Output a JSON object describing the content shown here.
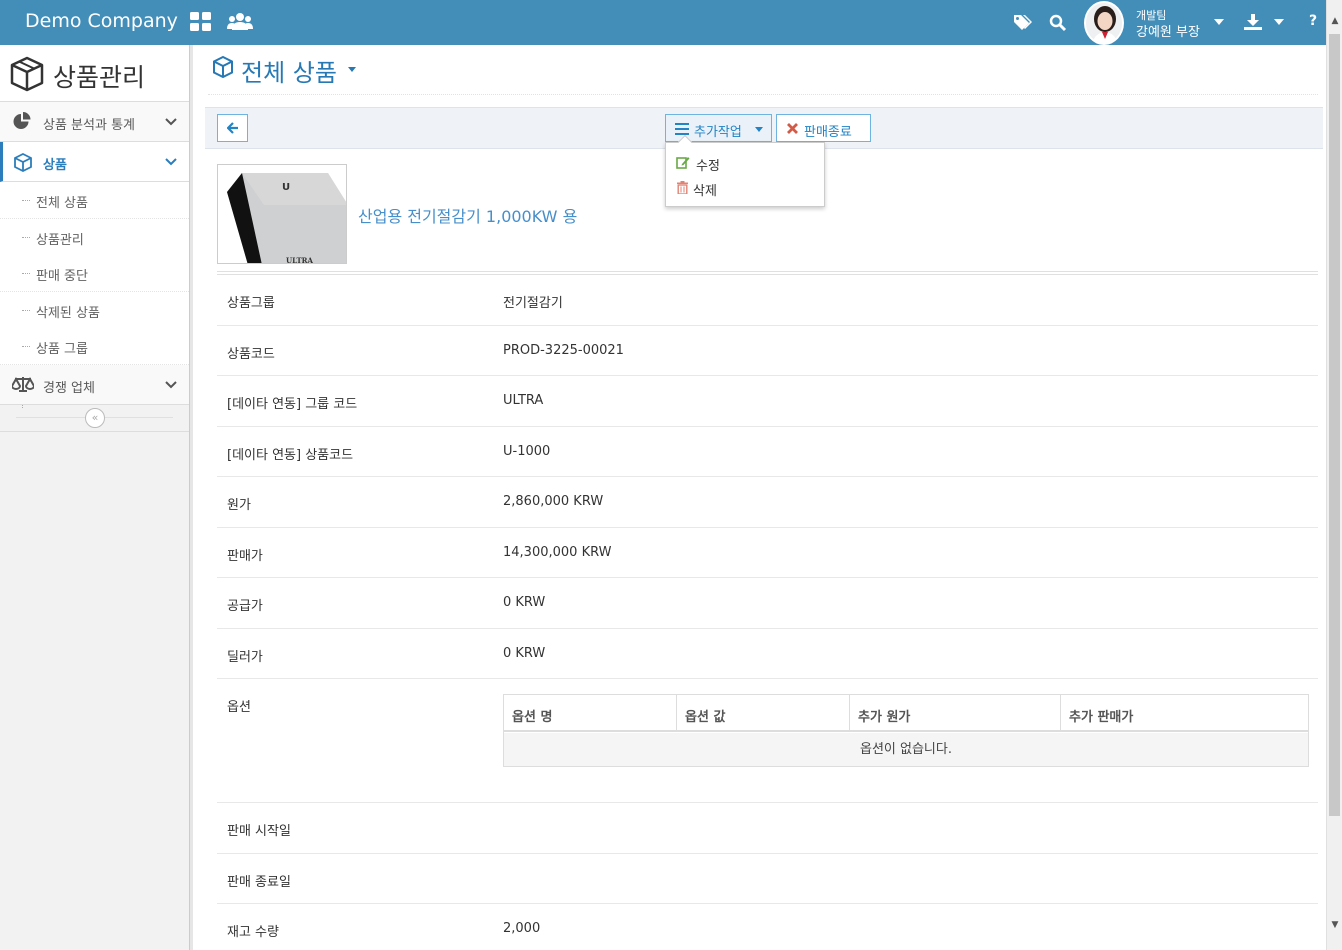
{
  "app": {
    "company": "Demo Company",
    "user_team": "개발팀",
    "user_name": "강예원 부장"
  },
  "sidebar": {
    "title": "상품관리",
    "items": [
      {
        "label": "상품 분석과 통계"
      },
      {
        "label": "상품"
      },
      {
        "label": "경쟁 업체"
      }
    ],
    "sub_items": [
      {
        "label": "전체 상품"
      },
      {
        "label": "상품관리"
      },
      {
        "label": "판매 중단"
      },
      {
        "label": "삭제된 상품"
      },
      {
        "label": "상품 그룹"
      }
    ]
  },
  "page": {
    "title": "전체 상품"
  },
  "toolbar": {
    "more_label": "추가작업",
    "end_sale_label": "판매종료"
  },
  "dropdown": {
    "items": [
      {
        "label": "수정",
        "icon": "edit-icon"
      },
      {
        "label": "삭제",
        "icon": "trash-icon"
      }
    ]
  },
  "product": {
    "name": "산업용 전기절감기 1,000KW 용",
    "thumb_text": "ULTRA",
    "thumb_logo": "U"
  },
  "details": [
    {
      "label": "상품그룹",
      "value": "전기절감기"
    },
    {
      "label": "상품코드",
      "value": "PROD-3225-00021"
    },
    {
      "label": "[데이타 연동] 그룹 코드",
      "value": "ULTRA"
    },
    {
      "label": "[데이타 연동] 상품코드",
      "value": "U-1000"
    },
    {
      "label": "원가",
      "value": "2,860,000 KRW"
    },
    {
      "label": "판매가",
      "value": "14,300,000 KRW"
    },
    {
      "label": "공급가",
      "value": "0 KRW"
    },
    {
      "label": "딜러가",
      "value": "0 KRW"
    },
    {
      "label": "옵션",
      "value": ""
    },
    {
      "label": "판매 시작일",
      "value": ""
    },
    {
      "label": "판매 종료일",
      "value": ""
    },
    {
      "label": "재고 수량",
      "value": "2,000"
    }
  ],
  "options_table": {
    "headers": [
      "옵션 명",
      "옵션 값",
      "추가 원가",
      "추가 판매가"
    ],
    "empty_text": "옵션이 없습니다."
  },
  "colors": {
    "topbar": "#438eb9",
    "accent": "#2679b5",
    "danger": "#d15b47"
  }
}
